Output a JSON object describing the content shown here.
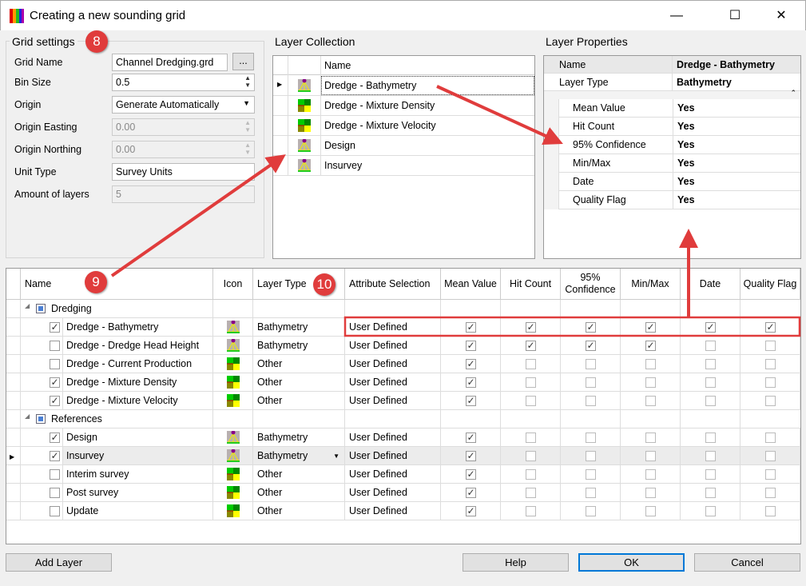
{
  "window": {
    "title": "Creating a new sounding grid",
    "minimize": "—",
    "maximize": "☐",
    "close": "✕"
  },
  "grid_settings": {
    "title": "Grid settings",
    "badge": "8",
    "fields": [
      {
        "label": "Grid Name",
        "value": "Channel Dredging.grd",
        "kind": "browse",
        "browse": "..."
      },
      {
        "label": "Bin Size",
        "value": "0.5",
        "kind": "spin"
      },
      {
        "label": "Origin",
        "value": "Generate Automatically",
        "kind": "dropdown"
      },
      {
        "label": "Origin Easting",
        "value": "0.00",
        "kind": "spin-disabled"
      },
      {
        "label": "Origin Northing",
        "value": "0.00",
        "kind": "spin-disabled"
      },
      {
        "label": "Unit Type",
        "value": "Survey Units",
        "kind": "text"
      },
      {
        "label": "Amount of layers",
        "value": "5",
        "kind": "disabled"
      }
    ]
  },
  "layer_collection": {
    "title": "Layer Collection",
    "header": "Name",
    "items": [
      {
        "name": "Dredge - Bathymetry",
        "icon": "bathy",
        "selected": true
      },
      {
        "name": "Dredge - Mixture Density",
        "icon": "other"
      },
      {
        "name": "Dredge - Mixture Velocity",
        "icon": "other"
      },
      {
        "name": "Design",
        "icon": "bathy"
      },
      {
        "name": "Insurvey",
        "icon": "bathy"
      }
    ]
  },
  "layer_properties": {
    "title": "Layer Properties",
    "top": [
      {
        "k": "Name",
        "v": "Dredge - Bathymetry"
      },
      {
        "k": "Layer Type",
        "v": "Bathymetry"
      }
    ],
    "attrs": [
      {
        "k": "Mean Value",
        "v": "Yes"
      },
      {
        "k": "Hit Count",
        "v": "Yes"
      },
      {
        "k": "95% Confidence",
        "v": "Yes"
      },
      {
        "k": "Min/Max",
        "v": "Yes"
      },
      {
        "k": "Date",
        "v": "Yes"
      },
      {
        "k": "Quality Flag",
        "v": "Yes"
      }
    ]
  },
  "grid": {
    "headers": [
      "Name",
      "Icon",
      "Layer Type",
      "Attribute Selection",
      "Mean Value",
      "Hit Count",
      "95% Confidence",
      "Min/Max",
      "Date",
      "Quality Flag"
    ],
    "badge9": "9",
    "badge10": "10",
    "groups": [
      {
        "name": "Dredging",
        "rows": [
          {
            "checked": true,
            "name": "Dredge - Bathymetry",
            "icon": "bathy",
            "type": "Bathymetry",
            "attr": "User Defined",
            "flags": [
              1,
              1,
              1,
              1,
              1,
              1
            ]
          },
          {
            "checked": false,
            "name": "Dredge - Dredge Head Height",
            "icon": "bathy",
            "type": "Bathymetry",
            "attr": "User Defined",
            "flags": [
              1,
              1,
              1,
              1,
              0,
              0
            ]
          },
          {
            "checked": false,
            "name": "Dredge - Current Production",
            "icon": "other",
            "type": "Other",
            "attr": "User Defined",
            "flags": [
              1,
              0,
              0,
              0,
              0,
              0
            ]
          },
          {
            "checked": true,
            "name": "Dredge - Mixture Density",
            "icon": "other",
            "type": "Other",
            "attr": "User Defined",
            "flags": [
              1,
              0,
              0,
              0,
              0,
              0
            ]
          },
          {
            "checked": true,
            "name": "Dredge - Mixture Velocity",
            "icon": "other",
            "type": "Other",
            "attr": "User Defined",
            "flags": [
              1,
              0,
              0,
              0,
              0,
              0
            ]
          }
        ]
      },
      {
        "name": "References",
        "rows": [
          {
            "checked": true,
            "name": "Design",
            "icon": "bathy",
            "type": "Bathymetry",
            "attr": "User Defined",
            "flags": [
              1,
              0,
              0,
              0,
              0,
              0
            ]
          },
          {
            "checked": true,
            "name": "Insurvey",
            "icon": "bathy",
            "type": "Bathymetry",
            "attr": "User Defined",
            "flags": [
              1,
              0,
              0,
              0,
              0,
              0
            ],
            "current": true
          },
          {
            "checked": false,
            "name": "Interim survey",
            "icon": "other",
            "type": "Other",
            "attr": "User Defined",
            "flags": [
              1,
              0,
              0,
              0,
              0,
              0
            ]
          },
          {
            "checked": false,
            "name": "Post survey",
            "icon": "other",
            "type": "Other",
            "attr": "User Defined",
            "flags": [
              1,
              0,
              0,
              0,
              0,
              0
            ]
          },
          {
            "checked": false,
            "name": "Update",
            "icon": "other",
            "type": "Other",
            "attr": "User Defined",
            "flags": [
              1,
              0,
              0,
              0,
              0,
              0
            ]
          }
        ]
      }
    ]
  },
  "buttons": {
    "add_layer": "Add Layer",
    "help": "Help",
    "ok": "OK",
    "cancel": "Cancel"
  },
  "colors": {
    "annotation": "#e03c3c"
  }
}
